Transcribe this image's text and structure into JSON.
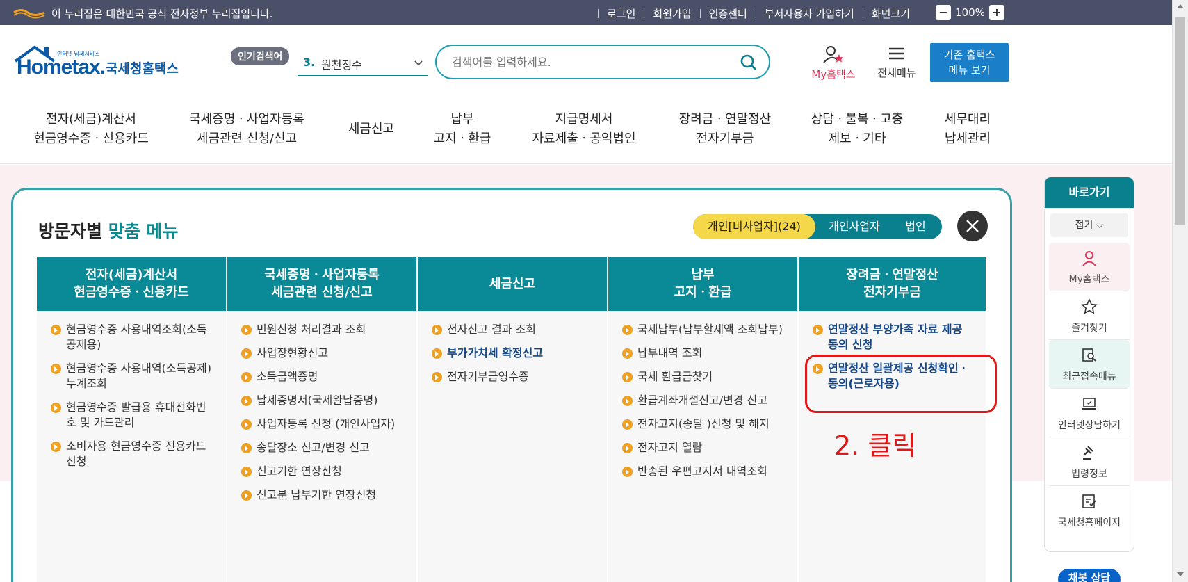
{
  "topbar": {
    "gov_notice": "이 누리집은 대한민국 공식 전자정부 누리집입니다.",
    "links": [
      "로그인",
      "회원가입",
      "인증센터",
      "부서사용자 가입하기",
      "화면크기"
    ],
    "zoom_minus": "−",
    "zoom_level": "100%",
    "zoom_plus": "+"
  },
  "header": {
    "logo_small": "인터넷 납세서비스",
    "logo_main": "Hometax.",
    "logo_kr": "국세청홈택스",
    "popular_label": "인기검색어",
    "popular_num": "3.",
    "popular_value": "원천징수",
    "search_placeholder": "검색어를 입력하세요.",
    "my_hometax": "My홈택스",
    "all_menu": "전체메뉴",
    "old_home_line1": "기존 홈택스",
    "old_home_line2": "메뉴 보기"
  },
  "mainnav": [
    {
      "l1": "전자(세금)계산서",
      "l2": "현금영수증ㆍ신용카드"
    },
    {
      "l1": "국세증명ㆍ사업자등록",
      "l2": "세금관련 신청/신고"
    },
    {
      "l1": "세금신고",
      "l2": ""
    },
    {
      "l1": "납부",
      "l2": "고지ㆍ환급"
    },
    {
      "l1": "지급명세서",
      "l2": "자료제출ㆍ공익법인"
    },
    {
      "l1": "장려금ㆍ연말정산",
      "l2": "전자기부금"
    },
    {
      "l1": "상담ㆍ불복ㆍ고충",
      "l2": "제보ㆍ기타"
    },
    {
      "l1": "세무대리",
      "l2": "납세관리"
    }
  ],
  "panel": {
    "title_a": "방문자별",
    "title_b": "맞춤 메뉴",
    "tabs": [
      "개인[비사업자](24)",
      "개인사업자",
      "법인"
    ],
    "columns": [
      {
        "h1": "전자(세금)계산서",
        "h2": "현금영수증ㆍ신용카드",
        "items": [
          "현금영수증 사용내역조회(소득공제용)",
          "현금영수증 사용내역(소득공제)누계조회",
          "현금영수증 발급용 휴대전화번호 및 카드관리",
          "소비자용 현금영수증 전용카드 신청"
        ]
      },
      {
        "h1": "국세증명ㆍ사업자등록",
        "h2": "세금관련 신청/신고",
        "items": [
          "민원신청 처리결과 조회",
          "사업장현황신고",
          "소득금액증명",
          "납세증명서(국세완납증명)",
          "사업자등록 신청 (개인사업자)",
          "송달장소 신고/변경 신고",
          "신고기한 연장신청",
          "신고분 납부기한 연장신청"
        ]
      },
      {
        "h1": "세금신고",
        "h2": "",
        "items": [
          "전자신고 결과 조회",
          "부가가치세 확정신고",
          "전자기부금영수증"
        ]
      },
      {
        "h1": "납부",
        "h2": "고지ㆍ환급",
        "items": [
          "국세납부(납부할세액 조회납부)",
          "납부내역 조회",
          "국세 환급금찾기",
          "환급계좌개설신고/변경 신고",
          "전자고지(송달 )신청 및 해지",
          "전자고지 열람",
          "반송된 우편고지서 내역조회"
        ]
      },
      {
        "h1": "장려금ㆍ연말정산",
        "h2": "전자기부금",
        "items": [
          "연말정산 부양가족 자료 제공 동의 신청",
          "연말정산 일괄제공 신청확인ㆍ동의(근로자용)"
        ]
      }
    ],
    "annotation": "2. 클릭"
  },
  "quick": {
    "title": "바로가기",
    "fold": "접기",
    "items": [
      "My홈택스",
      "즐겨찾기",
      "최근접속메뉴",
      "인터넷상담하기",
      "법령정보",
      "국세청홈페이지"
    ]
  },
  "chat": "채봇 상담"
}
